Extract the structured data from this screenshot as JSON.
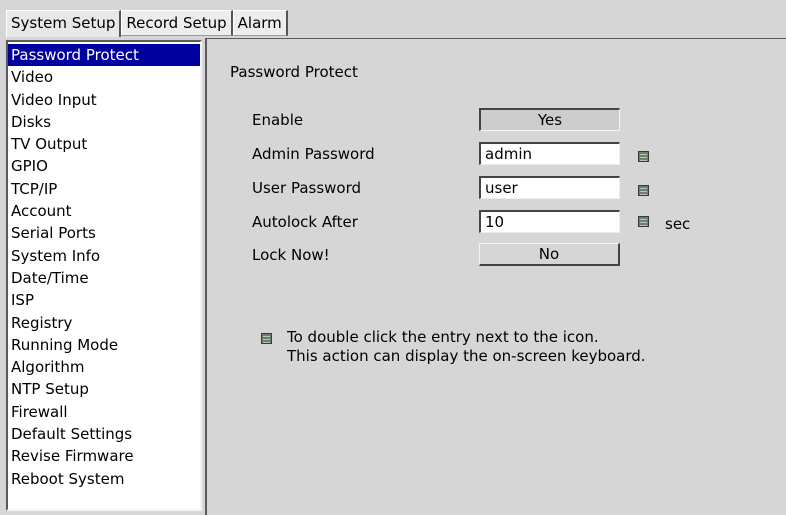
{
  "tabs": [
    "System Setup",
    "Record Setup",
    "Alarm"
  ],
  "sidebar": {
    "selected_index": 0,
    "items": [
      "Password Protect",
      "Video",
      "Video Input",
      "Disks",
      "TV Output",
      "GPIO",
      "TCP/IP",
      "Account",
      "Serial Ports",
      "System Info",
      "Date/Time",
      "ISP",
      "Registry",
      "Running Mode",
      "Algorithm",
      "NTP Setup",
      "Firewall",
      "Default Settings",
      "Revise Firmware",
      "Reboot System"
    ]
  },
  "panel": {
    "title": "Password Protect",
    "enable": {
      "label": "Enable",
      "value": "Yes"
    },
    "admin_password": {
      "label": "Admin Password",
      "value": "admin",
      "icon": "keyboard-icon"
    },
    "user_password": {
      "label": "User Password",
      "value": "user",
      "icon": "keyboard-icon"
    },
    "autolock": {
      "label": "Autolock After",
      "value": "10",
      "unit": "sec",
      "icon": "keyboard-icon"
    },
    "lock_now": {
      "label": "Lock Now!",
      "value": "No"
    },
    "hint": {
      "line1": "To double click the entry next to the icon.",
      "line2": "This action can display the on-screen keyboard.",
      "icon": "keyboard-icon"
    }
  },
  "colors": {
    "background": "#d6d6d6",
    "selection": "#0000a0",
    "list_background": "#ffffff",
    "icon_green": "#6e7e6e"
  }
}
